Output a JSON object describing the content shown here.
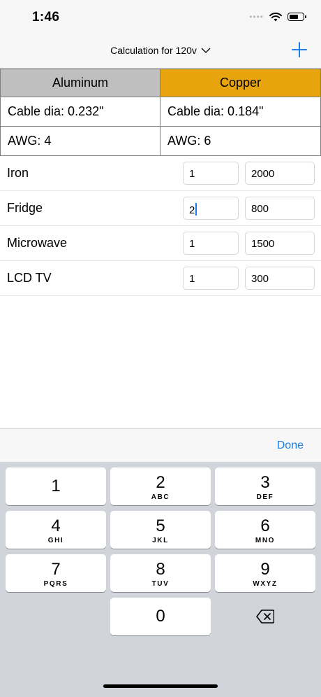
{
  "status_bar": {
    "time": "1:46",
    "signal": "••••"
  },
  "nav": {
    "title": "Calculation for 120v"
  },
  "metals": [
    {
      "name": "Aluminum",
      "dia": "Cable dia: 0.232\"",
      "awg": "AWG: 4",
      "color": "#bfbfbf"
    },
    {
      "name": "Copper",
      "dia": "Cable dia: 0.184\"",
      "awg": "AWG: 6",
      "color": "#e8a40c"
    }
  ],
  "appliances": [
    {
      "name": "Iron",
      "qty": "1",
      "watts": "2000"
    },
    {
      "name": "Fridge",
      "qty": "2",
      "watts": "800"
    },
    {
      "name": "Microwave",
      "qty": "1",
      "watts": "1500"
    },
    {
      "name": "LCD TV",
      "qty": "1",
      "watts": "300"
    }
  ],
  "accessory": {
    "done_label": "Done"
  },
  "keypad": {
    "keys": [
      {
        "num": "1",
        "letters": ""
      },
      {
        "num": "2",
        "letters": "ABC"
      },
      {
        "num": "3",
        "letters": "DEF"
      },
      {
        "num": "4",
        "letters": "GHI"
      },
      {
        "num": "5",
        "letters": "JKL"
      },
      {
        "num": "6",
        "letters": "MNO"
      },
      {
        "num": "7",
        "letters": "PQRS"
      },
      {
        "num": "8",
        "letters": "TUV"
      },
      {
        "num": "9",
        "letters": "WXYZ"
      },
      {
        "num": "0",
        "letters": ""
      }
    ]
  },
  "colors": {
    "accent": "#1a7fe6",
    "copper": "#e8a40c",
    "aluminum": "#bfbfbf"
  },
  "icons": [
    "wifi-icon",
    "battery-icon",
    "add-icon",
    "chevron-down-icon",
    "backspace-icon"
  ]
}
